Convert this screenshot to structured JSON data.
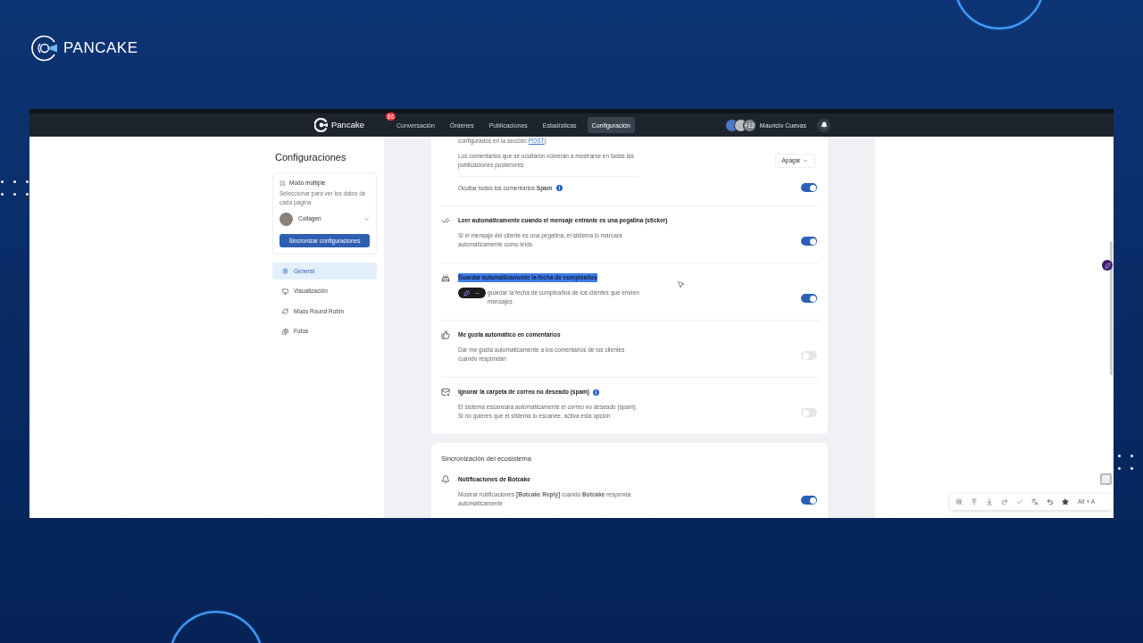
{
  "slide": {
    "brand": "PANCAKE"
  },
  "nav": {
    "logo": "Pancake",
    "items": [
      {
        "label": "Conversación",
        "selected": false,
        "badge": "66"
      },
      {
        "label": "Órdenes",
        "selected": false
      },
      {
        "label": "Publicaciones",
        "selected": false
      },
      {
        "label": "Estadísticas",
        "selected": false
      },
      {
        "label": "Configuración",
        "selected": true
      }
    ],
    "avatars_more": "+12",
    "user_name": "Mauricio Cuevas"
  },
  "sidebar": {
    "title": "Configuraciones",
    "multi_mode": {
      "title": "Modo múltiple",
      "hint": "Seleccionar para ver los datos de cada página",
      "page": "Collagen",
      "sync_button": "Sincronizar configuraciones"
    },
    "items": [
      {
        "label": "General",
        "selected": true
      },
      {
        "label": "Visualización",
        "selected": false
      },
      {
        "label": "Modo Round Robin",
        "selected": false
      },
      {
        "label": "Fotos",
        "selected": false
      }
    ]
  },
  "settings_card": {
    "note": "configurados en la sección",
    "note_link": "POST",
    "note_end": ")",
    "restore_note": "Los comentarios que se ocultaron volverán a mostrarse en todas las publicaciones posteriores:",
    "restore_select": "Apagar",
    "hide_spam": {
      "text": "Ocultar todos los comentarios **Spam**",
      "info": true,
      "on": true
    },
    "rows": [
      {
        "title": "Leer automáticamente cuando el mensaje entrante es una pegatina (sticker)",
        "description": "Si el mensaje del cliente es una pegatina, el sistema lo marcará automáticamente como leído",
        "on": true,
        "info": false,
        "text_selected": false
      },
      {
        "title": "Guardar automáticamente la fecha de cumpleaños",
        "description": "guardar la fecha de cumpleaños de los clientes que envíen mensajes",
        "on": true,
        "info": false,
        "text_selected": true
      },
      {
        "title": "Me gusta automático en comentarios",
        "description": "Dar me gusta automáticamente a los comentarios de los clientes cuando respondan",
        "on": false,
        "info": false,
        "text_selected": false
      },
      {
        "title": "Ignorar la carpeta de correo no deseado (spam)",
        "description": "El sistema escaneará automáticamente el correo no deseado (spam). Si no quieres que el sistema lo escanee, activa esta opción",
        "on": false,
        "info": true,
        "text_selected": false
      }
    ]
  },
  "ecosystem_card": {
    "title": "Sincronización del ecosistema",
    "rows": [
      {
        "title": "Notificaciones de Botcake",
        "description": "Mostrar notificaciones **[Botcake Reply]** cuando **Botcake** responda automáticamente",
        "on": true,
        "info": false,
        "text_selected": false
      }
    ]
  },
  "bottom_toolbar": {
    "shortcut": "Alt + A"
  }
}
